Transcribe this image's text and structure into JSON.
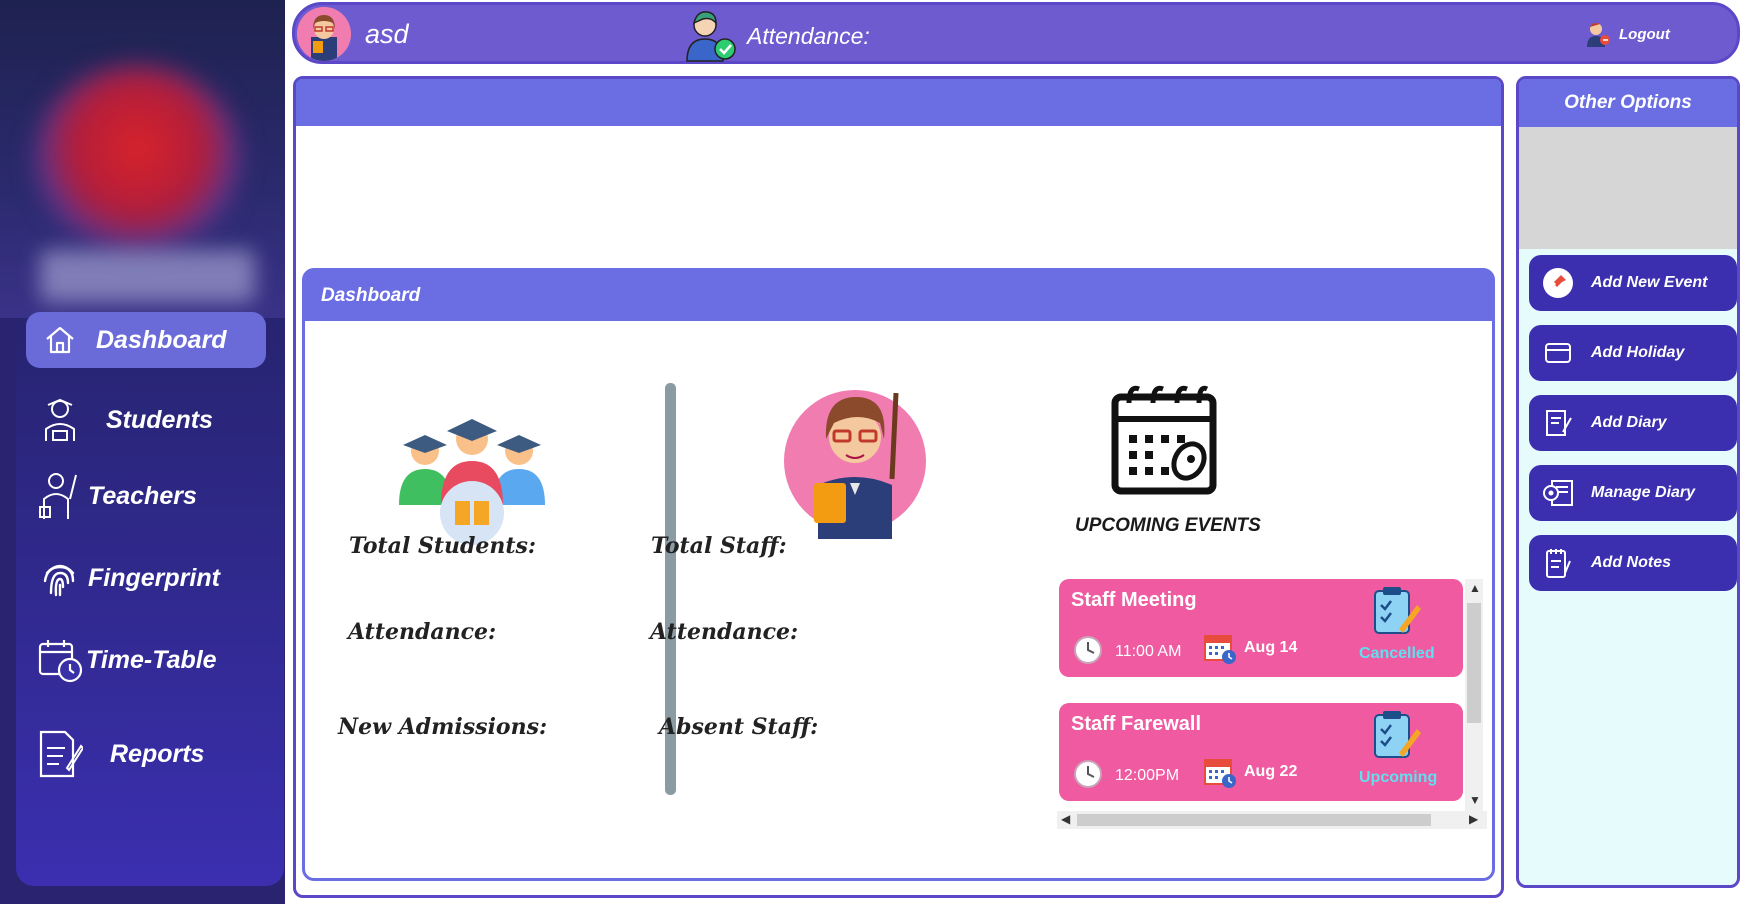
{
  "topbar": {
    "username": "asd",
    "attendance_label": "Attendance:",
    "logout_label": "Logout"
  },
  "sidebar": {
    "items": [
      {
        "label": "Dashboard",
        "icon": "home-icon",
        "active": true
      },
      {
        "label": "Students",
        "icon": "student-icon"
      },
      {
        "label": "Teachers",
        "icon": "teacher-icon"
      },
      {
        "label": "Fingerprint",
        "icon": "fingerprint-icon"
      },
      {
        "label": "Time-Table",
        "icon": "calendar-clock-icon"
      },
      {
        "label": "Reports",
        "icon": "report-icon"
      }
    ]
  },
  "dashboard": {
    "title": "Dashboard",
    "students": {
      "total_label": "Total Students:",
      "attendance_label": "Attendance:",
      "admissions_label": "New Admissions:"
    },
    "staff": {
      "total_label": "Total Staff:",
      "attendance_label": "Attendance:",
      "absent_label": "Absent Staff:"
    },
    "upcoming_title": "UPCOMING EVENTS",
    "events": [
      {
        "title": "Staff Meeting",
        "time": "11:00 AM",
        "date": "Aug 14",
        "status": "Cancelled"
      },
      {
        "title": "Staff Farewall",
        "time": "12:00PM",
        "date": "Aug 22",
        "status": "Upcoming"
      }
    ]
  },
  "right_panel": {
    "title": "Other Options",
    "buttons": [
      {
        "label": "Add New Event",
        "icon": "pin-icon"
      },
      {
        "label": "Add Holiday",
        "icon": "card-icon"
      },
      {
        "label": "Add Diary",
        "icon": "diary-icon"
      },
      {
        "label": "Manage Diary",
        "icon": "manage-diary-icon"
      },
      {
        "label": "Add Notes",
        "icon": "notes-icon"
      }
    ]
  },
  "colors": {
    "topbar": "#6e5bd0",
    "header": "#6a6ee2",
    "sidebar": "#2a2470",
    "event_card": "#ef5aa0",
    "button": "#3b2fb0"
  }
}
